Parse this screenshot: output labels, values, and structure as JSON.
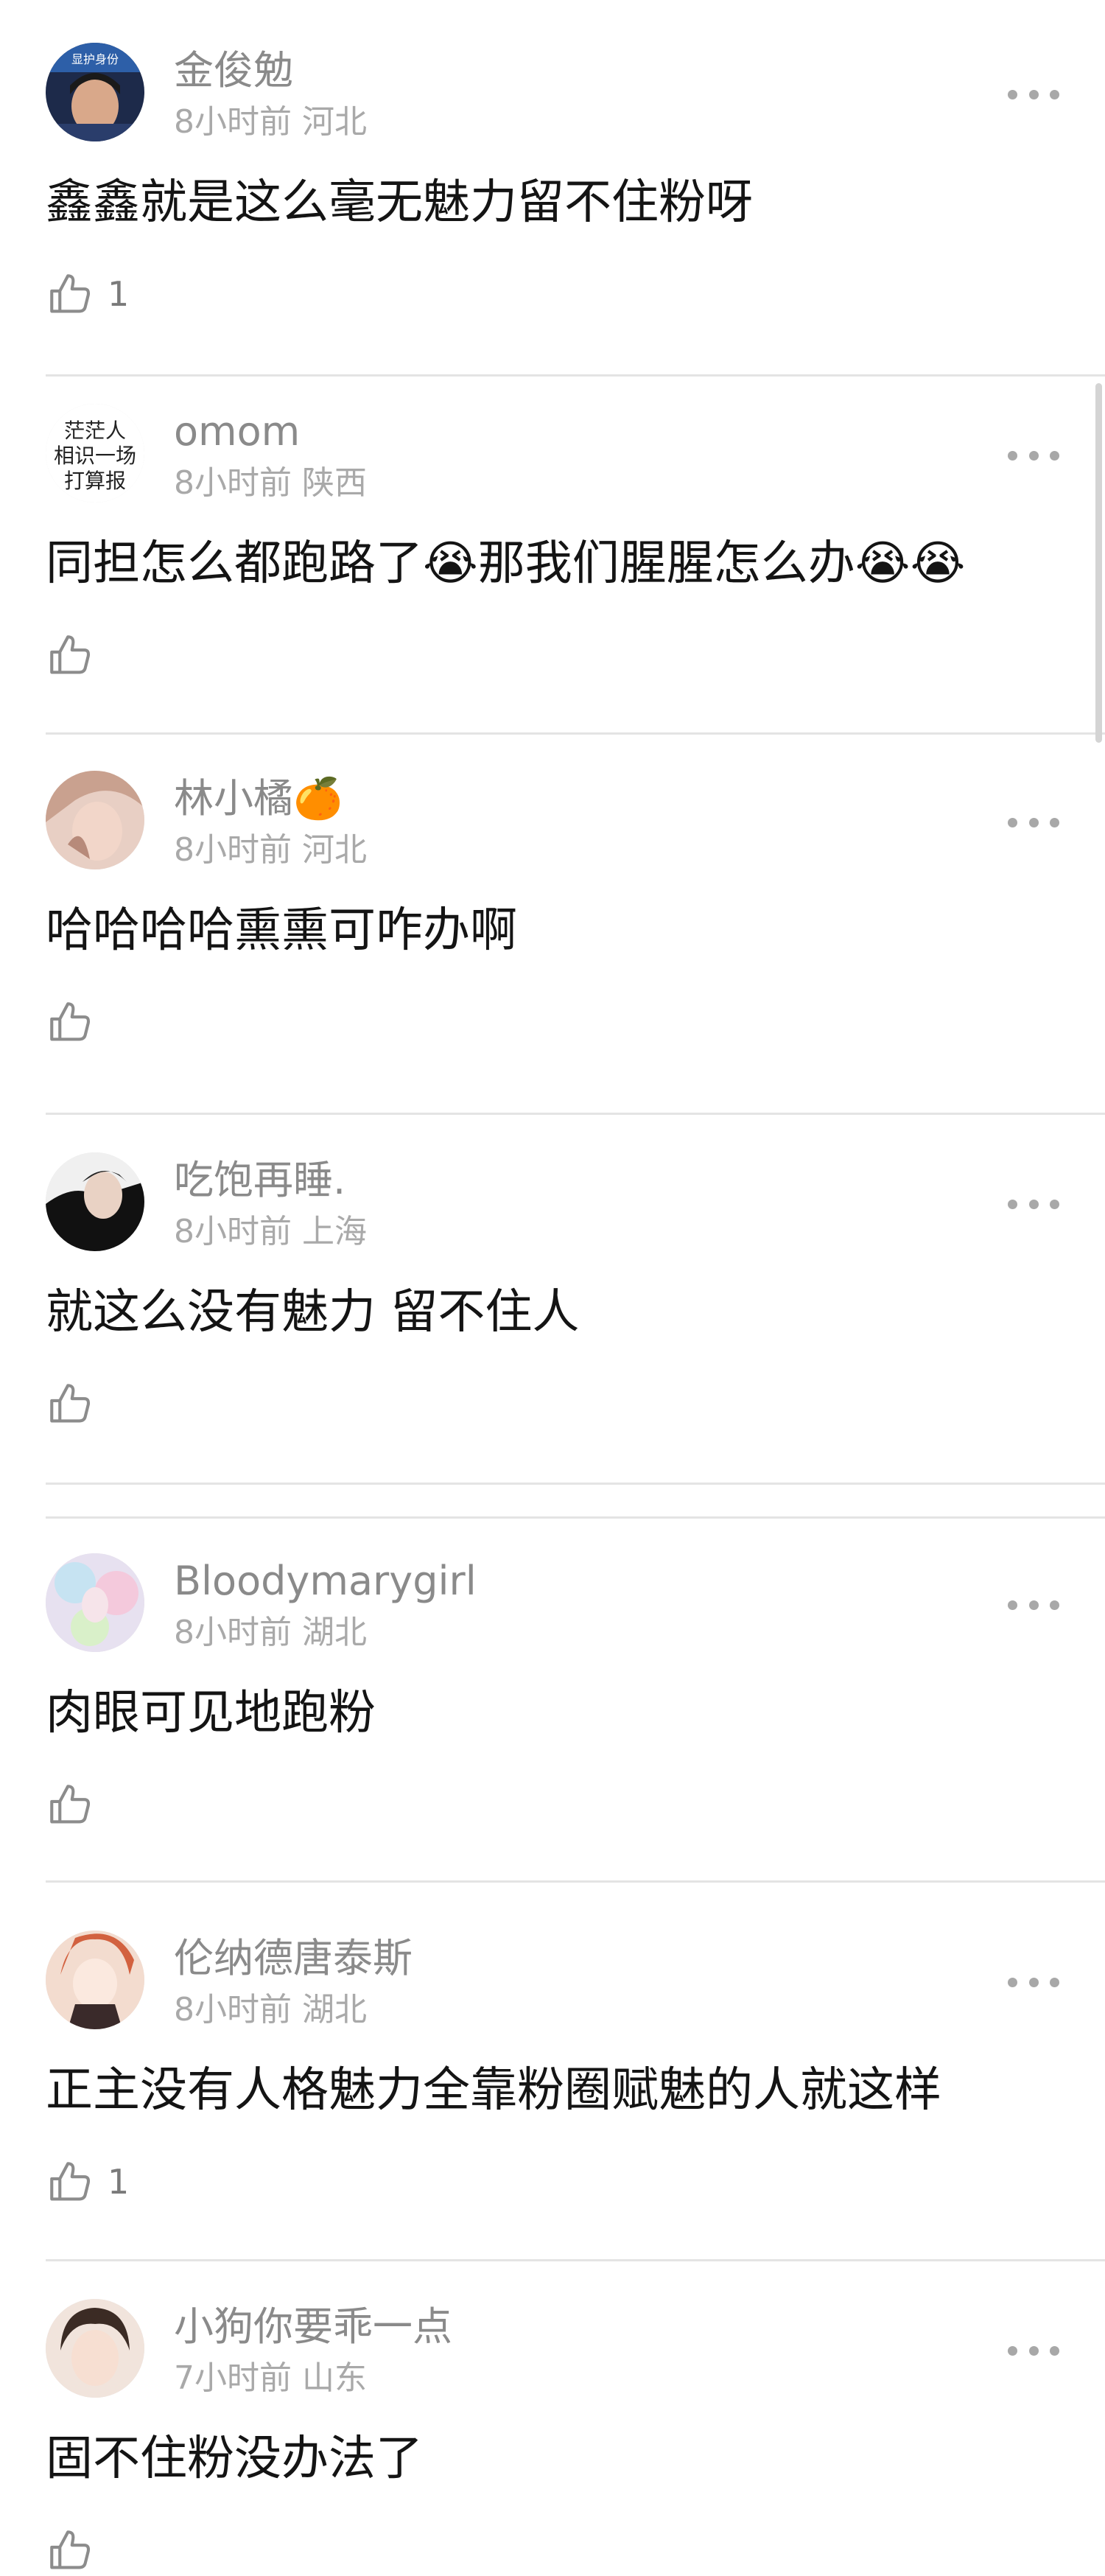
{
  "comments": [
    {
      "user": "金俊勉",
      "time": "8小时前",
      "location": "河北",
      "text": "鑫鑫就是这么毫无魅力留不住粉呀",
      "emoji_suffix": "",
      "text2": "",
      "likes": "1"
    },
    {
      "user": "omom",
      "time": "8小时前",
      "location": "陕西",
      "text": "同担怎么都跑路了",
      "emoji1": "😭",
      "text2": "那我们腥腥怎么办",
      "emoji2": "😭😭",
      "likes": ""
    },
    {
      "user": "林小橘",
      "user_emoji": "🍊",
      "time": "8小时前",
      "location": "河北",
      "text": "哈哈哈哈熏熏可咋办啊",
      "likes": ""
    },
    {
      "user": "吃饱再睡.",
      "time": "8小时前",
      "location": "上海",
      "text": "就这么没有魅力 留不住人",
      "likes": ""
    },
    {
      "user": "Bloodymarygirl",
      "time": "8小时前",
      "location": "湖北",
      "text": "肉眼可见地跑粉",
      "likes": ""
    },
    {
      "user": "伦纳德唐泰斯",
      "time": "8小时前",
      "location": "湖北",
      "text": "正主没有人格魅力全靠粉圈赋魅的人就这样",
      "likes": "1"
    },
    {
      "user": "小狗你要乖一点",
      "time": "7小时前",
      "location": "山东",
      "text": "固不住粉没办法了",
      "likes": ""
    }
  ],
  "avatars": {
    "a0_text": "显护身份",
    "a1_line1": "茫茫人",
    "a1_line2": "相识一场",
    "a1_line3": "打算报"
  },
  "colors": {
    "username": "#8a8a8a",
    "meta": "#a9a9a9",
    "divider": "#e4e4e4",
    "icon": "#8c8c8c"
  }
}
